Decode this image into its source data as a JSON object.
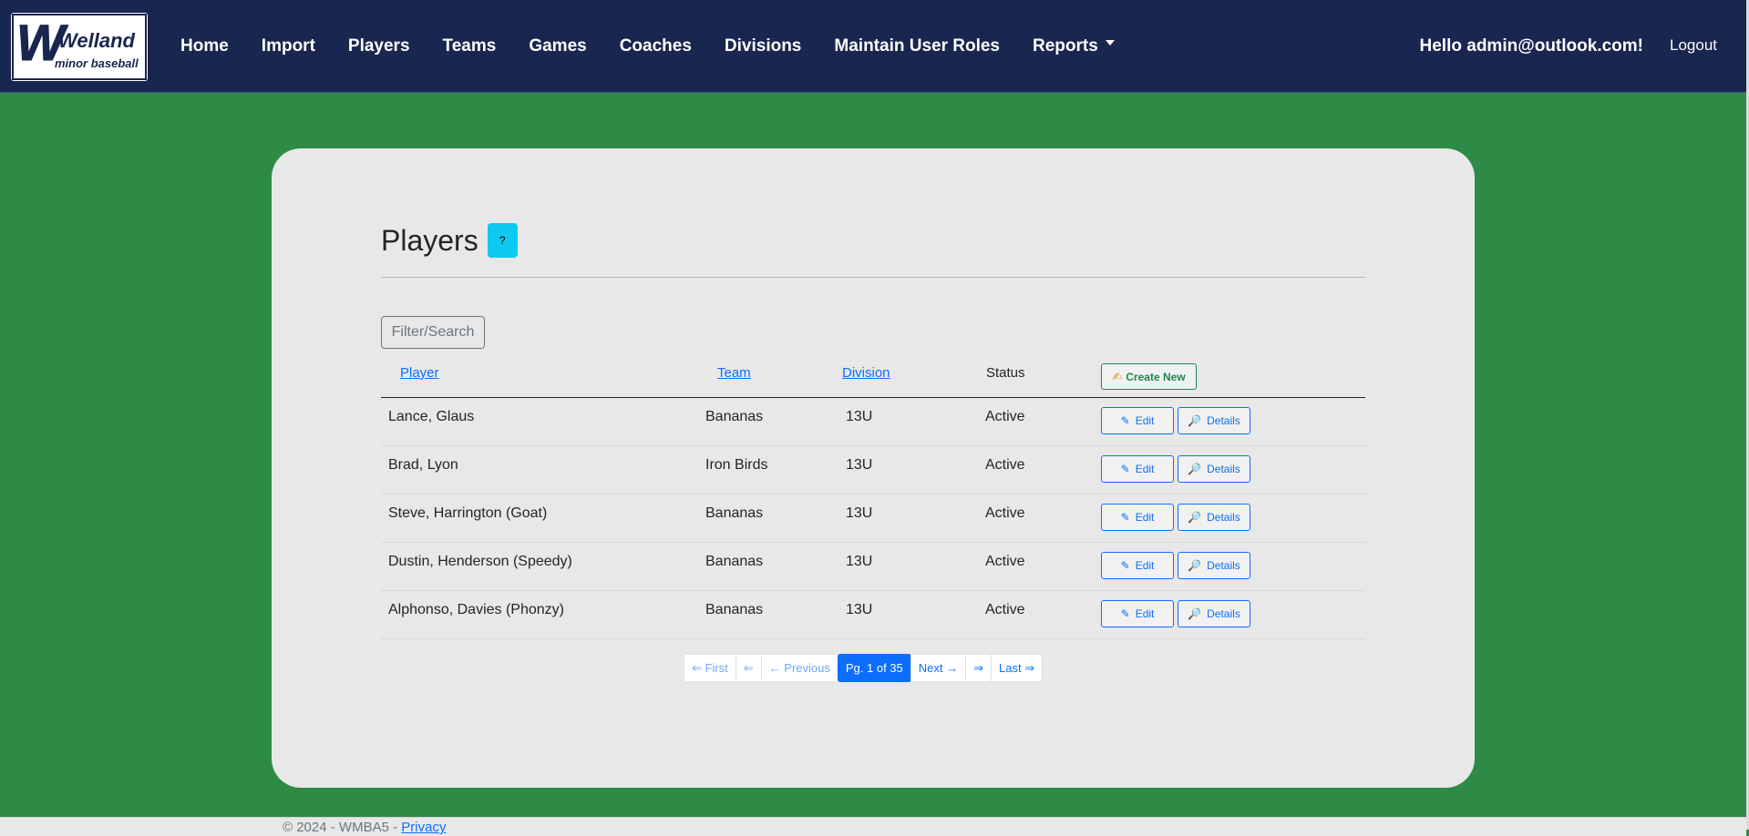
{
  "brand": {
    "logo_text_top": "Welland",
    "logo_text_bottom": "minor baseball"
  },
  "nav": {
    "items": [
      {
        "label": "Home"
      },
      {
        "label": "Import"
      },
      {
        "label": "Players"
      },
      {
        "label": "Teams"
      },
      {
        "label": "Games"
      },
      {
        "label": "Coaches"
      },
      {
        "label": "Divisions"
      },
      {
        "label": "Maintain User Roles"
      },
      {
        "label": "Reports"
      }
    ],
    "greeting": "Hello admin@outlook.com!",
    "logout": "Logout"
  },
  "page": {
    "title": "Players",
    "help_label": "?",
    "filter_label": "Filter/Search"
  },
  "table": {
    "headers": {
      "player": "Player",
      "team": "Team",
      "division": "Division",
      "status": "Status"
    },
    "create_label": "Create New",
    "edit_label": "Edit",
    "details_label": "Details",
    "rows": [
      {
        "player": "Lance, Glaus",
        "team": "Bananas",
        "division": "13U",
        "status": "Active"
      },
      {
        "player": "Brad, Lyon",
        "team": "Iron Birds",
        "division": "13U",
        "status": "Active"
      },
      {
        "player": "Steve, Harrington (Goat)",
        "team": "Bananas",
        "division": "13U",
        "status": "Active"
      },
      {
        "player": "Dustin, Henderson (Speedy)",
        "team": "Bananas",
        "division": "13U",
        "status": "Active"
      },
      {
        "player": "Alphonso, Davies (Phonzy)",
        "team": "Bananas",
        "division": "13U",
        "status": "Active"
      }
    ]
  },
  "pagination": {
    "first": "⇐ First",
    "first_arrow": "⇐",
    "previous": "← Previous",
    "current": "Pg. 1 of 35",
    "next": "Next →",
    "last_arrow": "⇒",
    "last": "Last ⇒"
  },
  "footer": {
    "text": "© 2024 - WMBA5 - ",
    "privacy": "Privacy"
  },
  "colors": {
    "navbar": "#19264f",
    "background": "#2e8b45",
    "card": "#e8e8e8",
    "primary": "#0d6efd",
    "success": "#198754",
    "info": "#0dcaf0"
  },
  "icons": {
    "edit": "pencil-icon",
    "details": "magnifier-icon",
    "create": "writing-hand-icon"
  }
}
